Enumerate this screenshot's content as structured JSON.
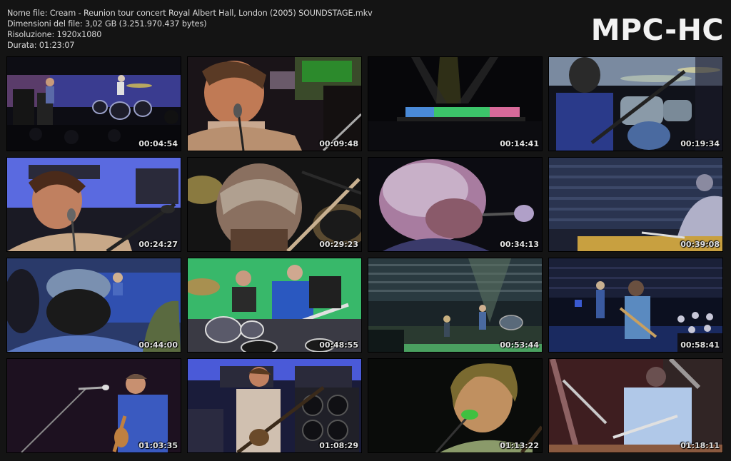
{
  "file_info": {
    "name_line": "Nome file: Cream - Reunion tour concert Royal Albert Hall, London (2005) SOUNDSTAGE.mkv",
    "size_line": "Dimensioni del file: 3,02 GB (3.251.970.437 bytes)",
    "resolution_line": "Risoluzione: 1920x1080",
    "duration_line": "Durata: 01:23:07"
  },
  "logo_text": "MPC-HC",
  "thumbnails": [
    {
      "timestamp": "00:04:54",
      "scene": "band-wide-stage"
    },
    {
      "timestamp": "00:09:48",
      "scene": "singer-closeup"
    },
    {
      "timestamp": "00:14:41",
      "scene": "arena-wide-shot"
    },
    {
      "timestamp": "00:19:34",
      "scene": "guitarist-drums-blue"
    },
    {
      "timestamp": "00:24:27",
      "scene": "bassist-singing"
    },
    {
      "timestamp": "00:29:23",
      "scene": "drummer-from-behind"
    },
    {
      "timestamp": "00:34:13",
      "scene": "blurred-head-mic"
    },
    {
      "timestamp": "00:39:08",
      "scene": "audience-and-drummer"
    },
    {
      "timestamp": "00:44:00",
      "scene": "audience-backs"
    },
    {
      "timestamp": "00:48:55",
      "scene": "trio-green-backdrop"
    },
    {
      "timestamp": "00:53:44",
      "scene": "hall-stage-wide"
    },
    {
      "timestamp": "00:58:41",
      "scene": "stage-blue-lights"
    },
    {
      "timestamp": "01:03:35",
      "scene": "guitarist-purple"
    },
    {
      "timestamp": "01:08:29",
      "scene": "bassist-amps"
    },
    {
      "timestamp": "01:13:22",
      "scene": "singer-green-light"
    },
    {
      "timestamp": "01:18:11",
      "scene": "guitarist-red-overlay"
    }
  ],
  "colors": {
    "background": "#141414",
    "info_text": "#d8d8d8",
    "logo_text": "#f2f2f2",
    "timestamp_text": "#e2e2e2"
  }
}
